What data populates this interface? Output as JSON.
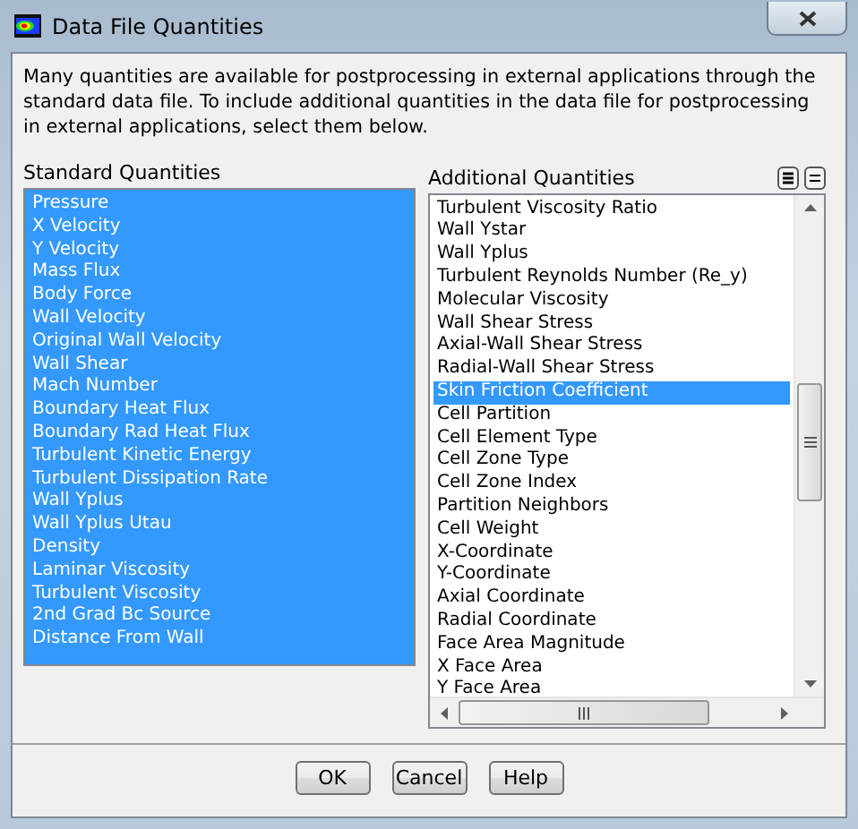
{
  "window": {
    "title": "Data File Quantities"
  },
  "description": "Many quantities are available for postprocessing in external applications through the standard data file. To include additional quantities in the data file for postprocessing in external applications, select them below.",
  "standard_quantities": {
    "label": "Standard Quantities",
    "items": [
      {
        "label": "Pressure",
        "selected": true
      },
      {
        "label": "X Velocity",
        "selected": true
      },
      {
        "label": "Y Velocity",
        "selected": true
      },
      {
        "label": "Mass Flux",
        "selected": true
      },
      {
        "label": "Body Force",
        "selected": true
      },
      {
        "label": "Wall Velocity",
        "selected": true
      },
      {
        "label": "Original Wall Velocity",
        "selected": true
      },
      {
        "label": "Wall Shear",
        "selected": true
      },
      {
        "label": "Mach Number",
        "selected": true
      },
      {
        "label": "Boundary Heat Flux",
        "selected": true
      },
      {
        "label": "Boundary Rad Heat Flux",
        "selected": true
      },
      {
        "label": "Turbulent Kinetic Energy",
        "selected": true
      },
      {
        "label": "Turbulent Dissipation Rate",
        "selected": true
      },
      {
        "label": "Wall Yplus",
        "selected": true
      },
      {
        "label": "Wall Yplus Utau",
        "selected": true
      },
      {
        "label": "Density",
        "selected": true
      },
      {
        "label": "Laminar Viscosity",
        "selected": true
      },
      {
        "label": "Turbulent Viscosity",
        "selected": true
      },
      {
        "label": "2nd Grad Bc Source",
        "selected": true
      },
      {
        "label": "Distance From Wall",
        "selected": true
      }
    ]
  },
  "additional_quantities": {
    "label": "Additional Quantities",
    "items": [
      {
        "label": "Turbulent Viscosity Ratio",
        "selected": false
      },
      {
        "label": "Wall Ystar",
        "selected": false
      },
      {
        "label": "Wall Yplus",
        "selected": false
      },
      {
        "label": "Turbulent Reynolds Number (Re_y)",
        "selected": false
      },
      {
        "label": "Molecular Viscosity",
        "selected": false
      },
      {
        "label": "Wall Shear Stress",
        "selected": false
      },
      {
        "label": "Axial-Wall Shear Stress",
        "selected": false
      },
      {
        "label": "Radial-Wall Shear Stress",
        "selected": false
      },
      {
        "label": "Skin Friction Coefficient",
        "selected": true
      },
      {
        "label": "Cell Partition",
        "selected": false
      },
      {
        "label": "Cell Element Type",
        "selected": false
      },
      {
        "label": "Cell Zone Type",
        "selected": false
      },
      {
        "label": "Cell Zone Index",
        "selected": false
      },
      {
        "label": "Partition Neighbors",
        "selected": false
      },
      {
        "label": "Cell Weight",
        "selected": false
      },
      {
        "label": "X-Coordinate",
        "selected": false
      },
      {
        "label": "Y-Coordinate",
        "selected": false
      },
      {
        "label": "Axial Coordinate",
        "selected": false
      },
      {
        "label": "Radial Coordinate",
        "selected": false
      },
      {
        "label": "Face Area Magnitude",
        "selected": false
      },
      {
        "label": "X Face Area",
        "selected": false
      },
      {
        "label": "Y Face Area",
        "selected": false
      }
    ]
  },
  "buttons": [
    "OK",
    "Cancel",
    "Help"
  ]
}
